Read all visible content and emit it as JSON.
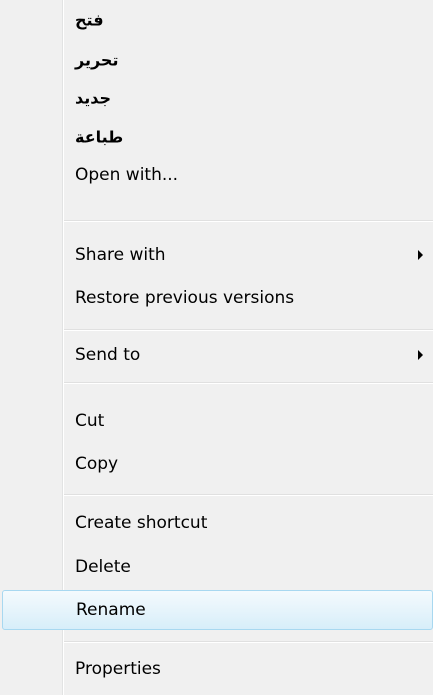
{
  "context_menu": {
    "items": [
      {
        "label": "فتح"
      },
      {
        "label": "تحرير"
      },
      {
        "label": "جديد"
      },
      {
        "label": "طباعة"
      },
      {
        "label": "Open with..."
      },
      {
        "label": "Share with"
      },
      {
        "label": "Restore previous versions"
      },
      {
        "label": "Send to"
      },
      {
        "label": "Cut"
      },
      {
        "label": "Copy"
      },
      {
        "label": "Create shortcut"
      },
      {
        "label": "Delete"
      },
      {
        "label": "Rename"
      },
      {
        "label": "Properties"
      }
    ],
    "hovered_item": "Rename"
  },
  "colors": {
    "menu_background": "#f0f0f0",
    "hover_border": "#a8d8f0",
    "hover_fill": "#e6f4fb"
  },
  "icons": {
    "submenu_arrow": "chevron-right-icon"
  }
}
